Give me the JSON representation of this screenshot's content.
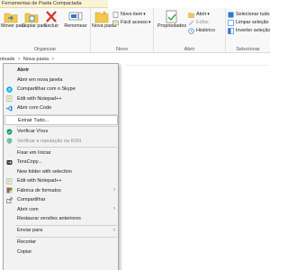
{
  "context_tab": {
    "title": "Ferramentas de Pasta Compactada"
  },
  "ribbon": {
    "organize": {
      "label": "Organizar",
      "move_to": "Mover para",
      "copy_to": "Copiar para",
      "delete": "Excluir",
      "rename": "Renomear"
    },
    "new": {
      "label": "Novo",
      "new_folder": "Nova pasta",
      "new_item": "Novo item",
      "easy_access": "Fácil acesso"
    },
    "open": {
      "label": "Abrir",
      "properties": "Propriedades",
      "open": "Abrir",
      "edit": "Editar",
      "history": "Histórico"
    },
    "select": {
      "label": "Selecionar",
      "select_all": "Selecionar tudo",
      "select_none": "Limpar seleção",
      "invert": "Inverter seleção"
    }
  },
  "address": {
    "part1": "nloads",
    "part2": "Nova pasta",
    "sep": ">"
  },
  "menu": {
    "items": [
      {
        "label": "Abrir"
      },
      {
        "label": "Abrir em nova janela"
      },
      {
        "label": "Compartilhar com o Skype"
      },
      {
        "label": "Edit with Notepad++"
      },
      {
        "label": "Abrir com Code"
      },
      {
        "label": "Extrair Tudo..."
      },
      {
        "label": "Verificar Vírus"
      },
      {
        "label": "Verificar a reputação na KSN"
      },
      {
        "label": "Fixar em Iniciar"
      },
      {
        "label": "TeraCopy..."
      },
      {
        "label": "New folder with selection"
      },
      {
        "label": "Edit with Notepad++"
      },
      {
        "label": "Fábrica de formatos"
      },
      {
        "label": "Compartilhar"
      },
      {
        "label": "Abrir com"
      },
      {
        "label": "Restaurar versões anteriores"
      },
      {
        "label": "Enviar para"
      },
      {
        "label": "Recortar"
      },
      {
        "label": "Copiar"
      }
    ],
    "submenu_arrow": "›"
  },
  "colors": {
    "ribbon_bg": "#f8f8f8",
    "menu_bg": "#f2f2f2",
    "context_tab_bg": "#fbf3d6",
    "folder_yellow": "#f2c94c",
    "delete_red": "#d9342b",
    "select_blue": "#2b79d0"
  },
  "icons": {
    "skype": "skype-icon",
    "vscode": "vscode-icon",
    "notepad": "notepad-plus-plus-icon",
    "kaspersky": "kaspersky-shield-icon",
    "teracopy": "teracopy-icon",
    "format_factory": "format-factory-icon",
    "share": "share-icon"
  }
}
